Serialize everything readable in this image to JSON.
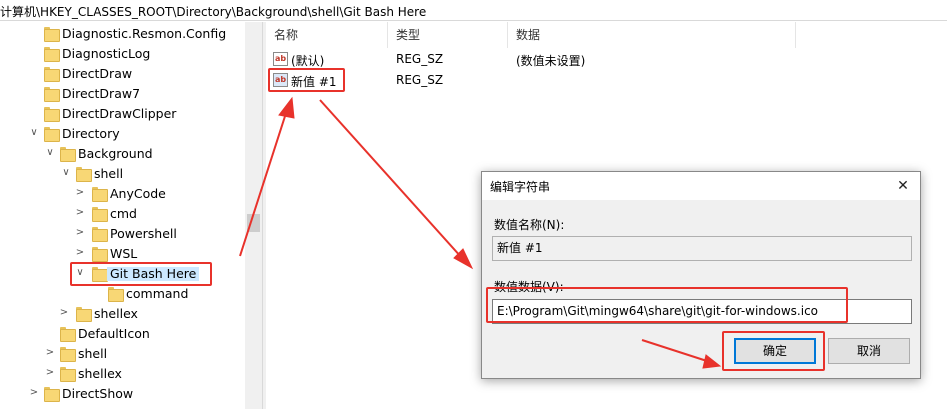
{
  "address": {
    "path": "计算机\\HKEY_CLASSES_ROOT\\Directory\\Background\\shell\\Git Bash Here"
  },
  "tree": {
    "items": [
      {
        "label": "Diagnostic.Resmon.Config",
        "chevron": ""
      },
      {
        "label": "DiagnosticLog",
        "chevron": ""
      },
      {
        "label": "DirectDraw",
        "chevron": ""
      },
      {
        "label": "DirectDraw7",
        "chevron": ""
      },
      {
        "label": "DirectDrawClipper",
        "chevron": ""
      },
      {
        "label": "Directory",
        "chevron": "∨"
      },
      {
        "label": "Background",
        "chevron": "∨"
      },
      {
        "label": "shell",
        "chevron": "∨"
      },
      {
        "label": "AnyCode",
        "chevron": ">"
      },
      {
        "label": "cmd",
        "chevron": ">"
      },
      {
        "label": "Powershell",
        "chevron": ">"
      },
      {
        "label": "WSL",
        "chevron": ">"
      },
      {
        "label": "Git Bash Here",
        "chevron": "∨"
      },
      {
        "label": "command",
        "chevron": ""
      },
      {
        "label": "shellex",
        "chevron": ">"
      },
      {
        "label": "DefaultIcon",
        "chevron": ""
      },
      {
        "label": "shell",
        "chevron": ">"
      },
      {
        "label": "shellex",
        "chevron": ">"
      },
      {
        "label": "DirectShow",
        "chevron": ">"
      }
    ]
  },
  "list": {
    "headers": {
      "name": "名称",
      "type": "类型",
      "data": "数据"
    },
    "rows": [
      {
        "icon": "ab",
        "name": "(默认)",
        "type": "REG_SZ",
        "data": "(数值未设置)"
      },
      {
        "icon": "ab",
        "name": "新值 #1",
        "type": "REG_SZ",
        "data": ""
      }
    ]
  },
  "dialog": {
    "title": "编辑字符串",
    "close_glyph": "✕",
    "name_label": "数值名称(N):",
    "name_value": "新值 #1",
    "data_label": "数值数据(V):",
    "data_value": "E:\\Program\\Git\\mingw64\\share\\git\\git-for-windows.ico",
    "ok_label": "确定",
    "cancel_label": "取消"
  },
  "colors": {
    "highlight": "#e8322b",
    "folder": "#f8d775",
    "selected_border": "#0078d7"
  }
}
